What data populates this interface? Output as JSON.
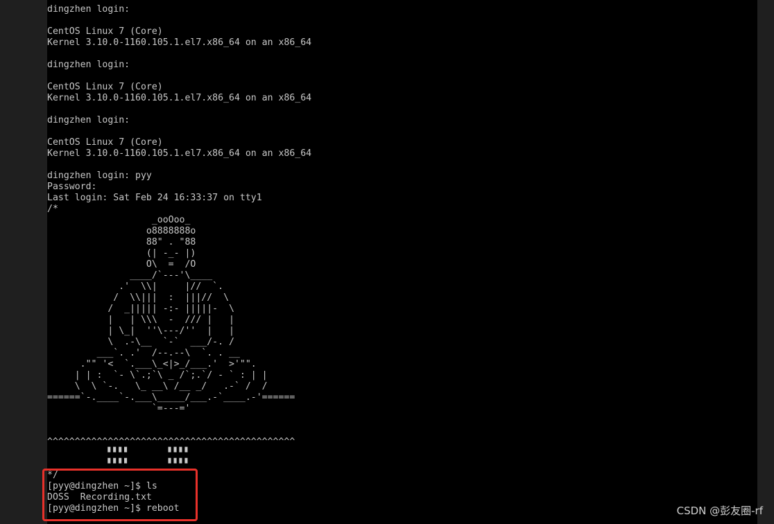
{
  "terminal": {
    "lines": [
      "dingzhen login:",
      "",
      "CentOS Linux 7 (Core)",
      "Kernel 3.10.0-1160.105.1.el7.x86_64 on an x86_64",
      "",
      "dingzhen login:",
      "",
      "CentOS Linux 7 (Core)",
      "Kernel 3.10.0-1160.105.1.el7.x86_64 on an x86_64",
      "",
      "dingzhen login:",
      "",
      "CentOS Linux 7 (Core)",
      "Kernel 3.10.0-1160.105.1.el7.x86_64 on an x86_64",
      "",
      "dingzhen login: pyy",
      "Password:",
      "Last login: Sat Feb 24 16:33:37 on tty1",
      "/*",
      "                   _ooOoo_",
      "                  o8888888o",
      "                  88\" . \"88",
      "                  (| -_- |)",
      "                  O\\  =  /O",
      "               ____/`---'\\____",
      "             .'  \\\\|     |//  `.",
      "            /  \\\\|||  :  |||//  \\",
      "           /  _||||| -:- |||||-  \\",
      "           |   | \\\\\\  -  /// |   |",
      "           | \\_|  ''\\---/''  |   |",
      "           \\  .-\\__  `-`  ___/-. /",
      "         ___`. .'  /--.--\\  `. . __",
      "      .\"\" '<  `.___\\_<|>_/___.'  >'\"\".",
      "     | | :  `- \\`.;`\\ _ /`;.`/ - ` : | |",
      "     \\  \\ `-.   \\_ __\\ /__ _/   .-` /  /",
      "======`-.____`-.___\\_____/___.-`____.-'======",
      "                   `=---='",
      "",
      "",
      "^^^^^^^^^^^^^^^^^^^^^^^^^^^^^^^^^^^^^^^^^^^^^",
      "           ▘▘▘▘       ▘▘▘▘",
      "           ▘▘▘▘       ▘▘▘▘",
      "*/",
      "[pyy@dingzhen ~]$ ls",
      "DOSS  Recording.txt",
      "[pyy@dingzhen ~]$ reboot"
    ]
  },
  "watermark": "CSDN @彭友圈-rf",
  "colors": {
    "terminal_bg": "#000000",
    "terminal_fg": "#c8c8c8",
    "highlight_border": "#e8312a",
    "outer_bg": "#1f1f1f"
  }
}
